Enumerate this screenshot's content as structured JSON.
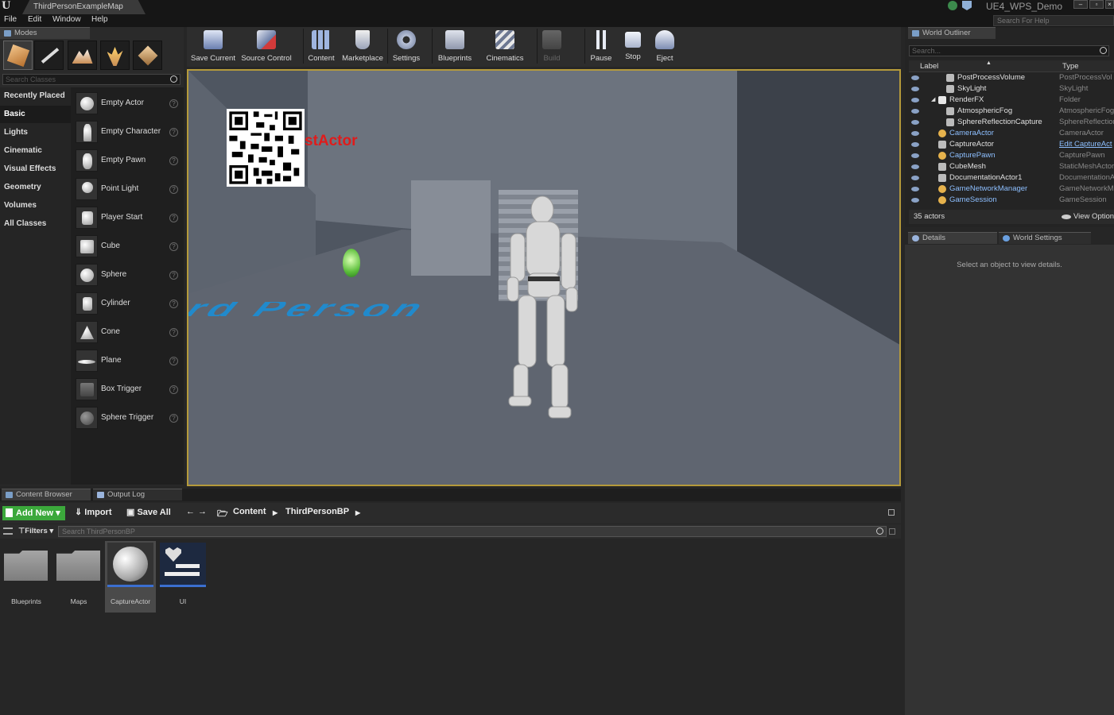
{
  "window": {
    "doc_tab": "ThirdPersonExampleMap",
    "project_name": "UE4_WPS_Demo",
    "help_search_placeholder": "Search For Help"
  },
  "menu": [
    "File",
    "Edit",
    "Window",
    "Help"
  ],
  "modes": {
    "tab_label": "Modes",
    "search_placeholder": "Search Classes",
    "categories": [
      "Recently Placed",
      "Basic",
      "Lights",
      "Cinematic",
      "Visual Effects",
      "Geometry",
      "Volumes",
      "All Classes"
    ],
    "selected_category": "Basic",
    "items": [
      "Empty Actor",
      "Empty Character",
      "Empty Pawn",
      "Point Light",
      "Player Start",
      "Cube",
      "Sphere",
      "Cylinder",
      "Cone",
      "Plane",
      "Box Trigger",
      "Sphere Trigger"
    ]
  },
  "toolbar": {
    "buttons": [
      "Save Current",
      "Source Control",
      "Content",
      "Marketplace",
      "Settings",
      "Blueprints",
      "Cinematics",
      "Build",
      "Pause",
      "Stop",
      "Eject"
    ]
  },
  "viewport": {
    "overlay_text": "stActor",
    "floor_text": "rd Person"
  },
  "outliner": {
    "tab_label": "World Outliner",
    "search_placeholder": "Search...",
    "col_label": "Label",
    "col_type": "Type",
    "rows": [
      {
        "name": "PostProcessVolume",
        "type": "PostProcessVol",
        "indent": 2,
        "highlight": false
      },
      {
        "name": "SkyLight",
        "type": "SkyLight",
        "indent": 2,
        "highlight": false
      },
      {
        "name": "RenderFX",
        "type": "Folder",
        "indent": 1,
        "highlight": false
      },
      {
        "name": "AtmosphericFog",
        "type": "AtmosphericFog",
        "indent": 2,
        "highlight": false
      },
      {
        "name": "SphereReflectionCapture",
        "type": "SphereReflection",
        "indent": 2,
        "highlight": false
      },
      {
        "name": "CameraActor",
        "type": "CameraActor",
        "indent": 1,
        "highlight": true
      },
      {
        "name": "CaptureActor",
        "type": "Edit CaptureAct",
        "indent": 1,
        "highlight": false
      },
      {
        "name": "CapturePawn",
        "type": "CapturePawn",
        "indent": 1,
        "highlight": true
      },
      {
        "name": "CubeMesh",
        "type": "StaticMeshActor",
        "indent": 1,
        "highlight": false
      },
      {
        "name": "DocumentationActor1",
        "type": "DocumentationA",
        "indent": 1,
        "highlight": false
      },
      {
        "name": "GameNetworkManager",
        "type": "GameNetworkMa",
        "indent": 1,
        "highlight": true
      },
      {
        "name": "GameSession",
        "type": "GameSession",
        "indent": 1,
        "highlight": true
      }
    ],
    "actor_count": "35 actors",
    "view_options": "View Option"
  },
  "details": {
    "tab_details": "Details",
    "tab_world_settings": "World Settings",
    "empty_text": "Select an object to view details."
  },
  "content_browser": {
    "tab_label": "Content Browser",
    "output_tab": "Output Log",
    "add_new": "Add New",
    "import": "Import",
    "save_all": "Save All",
    "path": [
      "Content",
      "ThirdPersonBP"
    ],
    "filters": "Filters",
    "search_placeholder": "Search ThirdPersonBP",
    "assets": [
      {
        "name": "Blueprints",
        "kind": "folder"
      },
      {
        "name": "Maps",
        "kind": "folder"
      },
      {
        "name": "CaptureActor",
        "kind": "blueprint"
      },
      {
        "name": "UI",
        "kind": "widget"
      }
    ],
    "selected_asset": "CaptureActor"
  },
  "colors": {
    "accent_green": "#3ba83b",
    "viewport_border": "#b59a3b",
    "overlay_red": "#e01b1b",
    "floor_text_blue": "#1b8fd6"
  }
}
